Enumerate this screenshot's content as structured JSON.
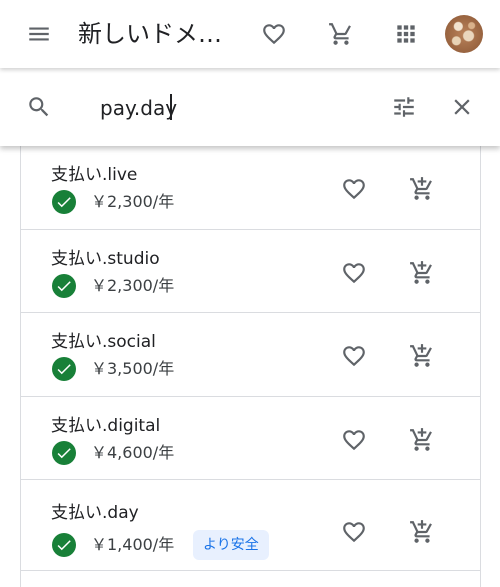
{
  "header": {
    "title": "新しいドメ…",
    "icons": [
      "menu-icon",
      "heart-icon",
      "shopping-cart-icon",
      "apps-grid-icon",
      "avatar"
    ]
  },
  "search": {
    "value": "pay.day",
    "icons": [
      "search-icon",
      "filter-tune-icon",
      "close-icon"
    ]
  },
  "results": [
    {
      "domain": "支払い.live",
      "price": "￥2,300/年",
      "badge": ""
    },
    {
      "domain": "支払い.studio",
      "price": "￥2,300/年",
      "badge": ""
    },
    {
      "domain": "支払い.social",
      "price": "￥3,500/年",
      "badge": ""
    },
    {
      "domain": "支払い.digital",
      "price": "￥4,600/年",
      "badge": ""
    },
    {
      "domain": "支払い.day",
      "price": "￥1,400/年",
      "badge": "より安全"
    }
  ],
  "colors": {
    "check_green": "#188038",
    "badge_bg": "#e8f0fe",
    "badge_text": "#1a73e8",
    "icon_gray": "#5f6368"
  }
}
